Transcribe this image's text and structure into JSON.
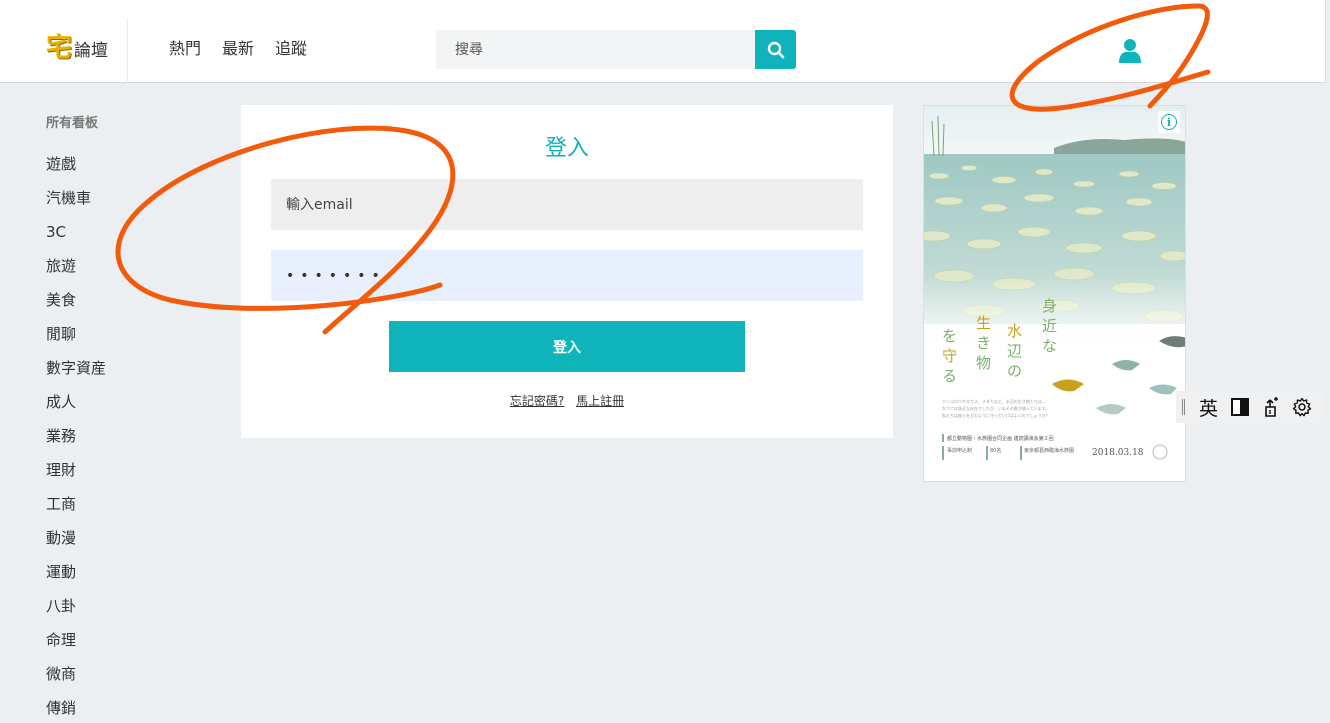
{
  "header": {
    "logo_mark": "宅",
    "logo_text": "論壇",
    "nav": [
      "熱門",
      "最新",
      "追蹤"
    ],
    "search_placeholder": "搜尋"
  },
  "sidebar": {
    "heading": "所有看板",
    "items": [
      "遊戲",
      "汽機車",
      "3C",
      "旅遊",
      "美食",
      "閒聊",
      "數字資産",
      "成人",
      "業務",
      "理財",
      "工商",
      "動漫",
      "運動",
      "八卦",
      "命理",
      "微商",
      "傳銷"
    ]
  },
  "login": {
    "title": "登入",
    "email_placeholder": "輸入email",
    "password_value": "•••••••",
    "submit_label": "登入",
    "forgot_label": "忘記密碼?",
    "register_label": "馬上註冊"
  },
  "ad": {
    "info_label": "i",
    "headline": [
      "身近な",
      "水辺の",
      "生き物",
      "を守る"
    ],
    "body_text": "ゲンゴロウやタガメ、メダカなど、水辺の生き物たちは…",
    "footer_line": "■ 都立動物園・水族園合同企画 連続講演会第２回",
    "date": "2018.03.18",
    "colors": {
      "water": "#a8cfc8",
      "lily": "#dfe9c9",
      "text_green": "#7ab16b",
      "text_gold": "#c8a21c"
    }
  },
  "ime": {
    "lang_label": "英",
    "icons": [
      "contrast-icon",
      "brush-icon",
      "settings-icon"
    ]
  },
  "colors": {
    "accent": "#0eb4ba",
    "annotation": "#f25a0c"
  }
}
